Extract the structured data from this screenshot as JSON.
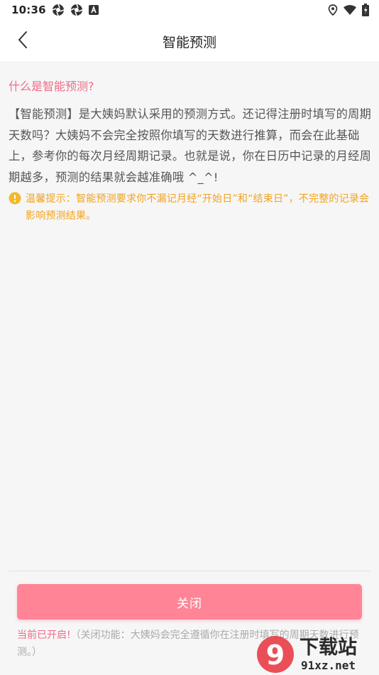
{
  "status_bar": {
    "time": "10:36",
    "left_icons": [
      "aperture-icon",
      "aperture-icon",
      "a-badge-icon"
    ],
    "right_icons": [
      "location-icon",
      "wifi-icon",
      "battery-icon"
    ]
  },
  "app_bar": {
    "back_icon": "chevron-left-icon",
    "title": "智能预测"
  },
  "content": {
    "question": "什么是智能预测?",
    "paragraph": "【智能预测】是大姨妈默认采用的预测方式。还记得注册时填写的周期天数吗？大姨妈不会完全按照你填写的天数进行推算，而会在此基础上，参考你的每次月经周期记录。也就是说，你在日历中记录的月经周期越多，预测的结果就会越准确哦 ^_^!",
    "tip_icon": "info-circle-icon",
    "tip": "温馨提示：智能预测要求你不漏记月经“开始日”和“结束日”，不完整的记录会影响预测结果。"
  },
  "footer": {
    "close_label": "关闭",
    "status_on": "当前已开启!",
    "status_desc": "（关闭功能：大姨妈会完全遵循你在注册时填写的周期天数进行预测。）"
  },
  "watermark": {
    "logo_text": "9",
    "site_name": "下载站",
    "site_domain": "91xz.net"
  },
  "colors": {
    "accent_pink": "#f06b87",
    "button_pink": "#ff8596",
    "tip_orange": "#f2a31e",
    "background": "#f6f6f6"
  }
}
